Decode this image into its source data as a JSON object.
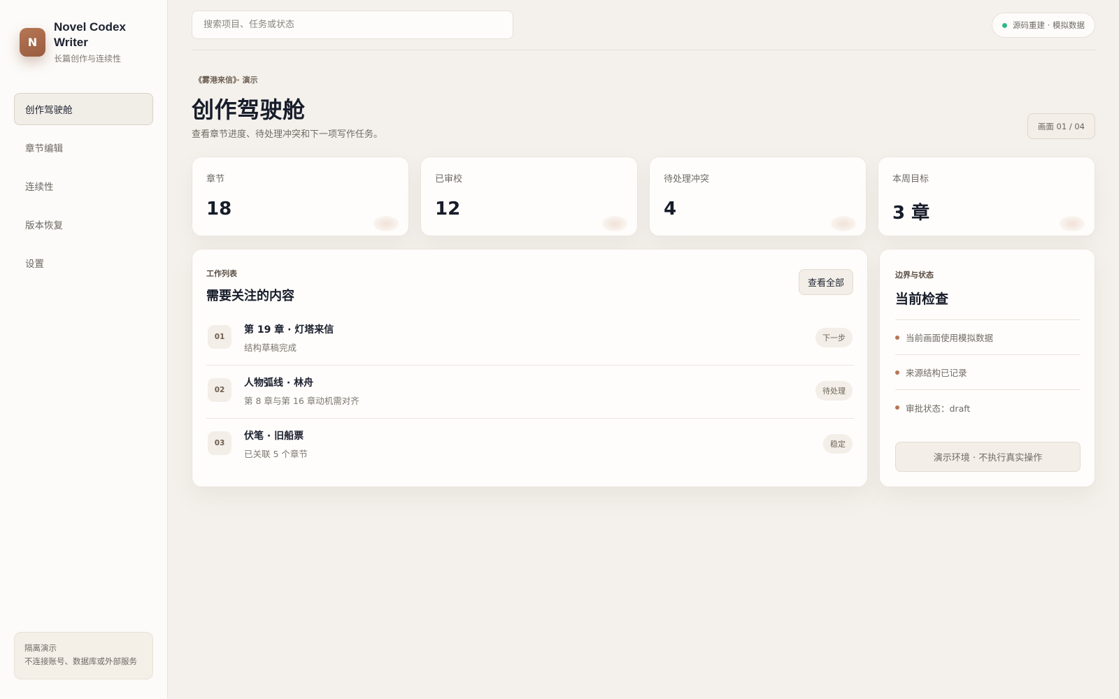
{
  "brand": {
    "logo_letter": "N",
    "name": "Novel Codex Writer",
    "subtitle": "长篇创作与连续性"
  },
  "nav": {
    "items": [
      {
        "label": "创作驾驶舱",
        "active": true
      },
      {
        "label": "章节编辑",
        "active": false
      },
      {
        "label": "连续性",
        "active": false
      },
      {
        "label": "版本恢复",
        "active": false
      },
      {
        "label": "设置",
        "active": false
      }
    ]
  },
  "sidebar_note": {
    "title": "隔离演示",
    "text": "不连接账号、数据库或外部服务"
  },
  "search": {
    "placeholder": "搜索项目、任务或状态",
    "value": ""
  },
  "status": {
    "label": "源码重建 · 模拟数据",
    "color": "#2fb88a"
  },
  "header": {
    "breadcrumb": "《雾港来信》· 演示",
    "title": "创作驾驶舱",
    "description": "查看章节进度、待处理冲突和下一项写作任务。",
    "frame_badge": "画面 01 / 04"
  },
  "stats": [
    {
      "label": "章节",
      "value": "18"
    },
    {
      "label": "已审校",
      "value": "12"
    },
    {
      "label": "待处理冲突",
      "value": "4"
    },
    {
      "label": "本周目标",
      "value": "3 章"
    }
  ],
  "worklist": {
    "eyebrow": "工作列表",
    "title": "需要关注的内容",
    "view_all_label": "查看全部",
    "tasks": [
      {
        "num": "01",
        "title": "第 19 章 · 灯塔来信",
        "sub": "结构草稿完成",
        "tag": "下一步"
      },
      {
        "num": "02",
        "title": "人物弧线 · 林舟",
        "sub": "第 8 章与第 16 章动机需对齐",
        "tag": "待处理"
      },
      {
        "num": "03",
        "title": "伏笔 · 旧船票",
        "sub": "已关联 5 个章节",
        "tag": "稳定"
      }
    ]
  },
  "checks": {
    "eyebrow": "边界与状态",
    "title": "当前检查",
    "items": [
      "当前画面使用模拟数据",
      "来源结构已记录",
      "审批状态：draft"
    ],
    "demo_button": "演示环境 · 不执行真实操作"
  },
  "colors": {
    "accent": "#b57654",
    "background": "#f4f1ec",
    "status_ok": "#2fb88a"
  }
}
